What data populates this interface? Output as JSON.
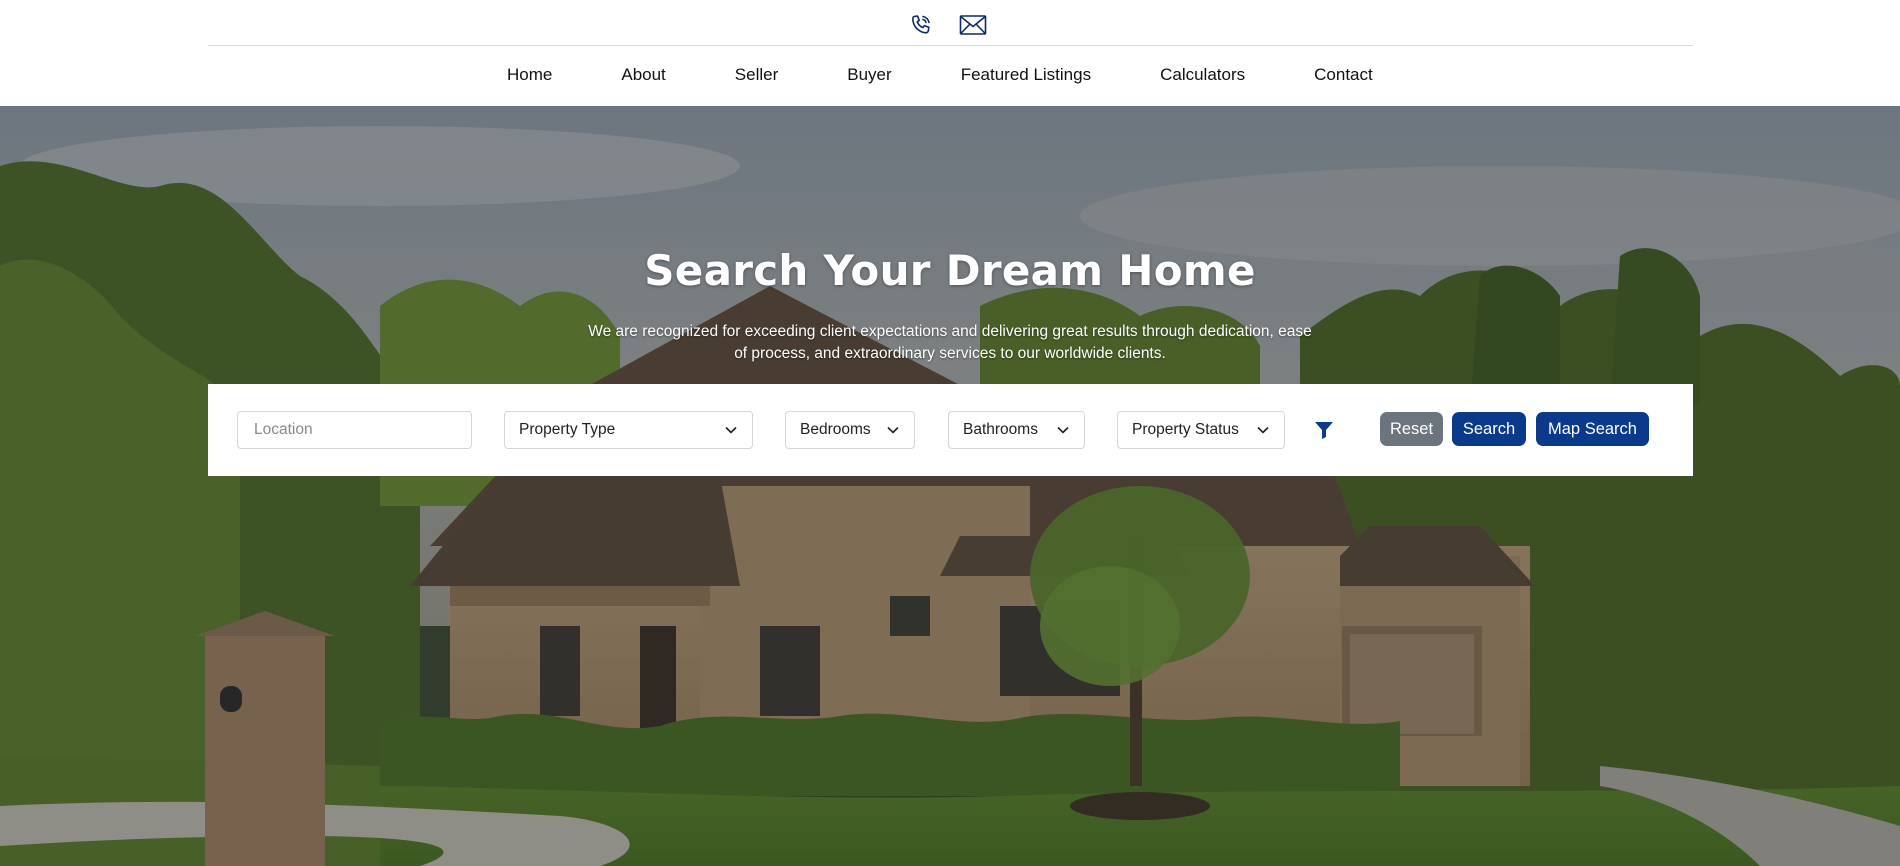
{
  "header": {
    "icons": [
      "phone-icon",
      "mail-icon"
    ],
    "nav": [
      {
        "label": "Home"
      },
      {
        "label": "About"
      },
      {
        "label": "Seller"
      },
      {
        "label": "Buyer"
      },
      {
        "label": "Featured Listings"
      },
      {
        "label": "Calculators"
      },
      {
        "label": "Contact"
      }
    ]
  },
  "hero": {
    "title": "Search Your Dream Home",
    "subtitle": "We are recognized for exceeding client expectations and delivering great results through dedication, ease of process, and extraordinary services to our worldwide clients."
  },
  "search": {
    "location_placeholder": "Location",
    "property_type": "Property Type",
    "bedrooms": "Bedrooms",
    "bathrooms": "Bathrooms",
    "property_status": "Property Status",
    "reset_label": "Reset",
    "search_label": "Search",
    "map_search_label": "Map Search",
    "filter_icon": "filter-icon"
  },
  "colors": {
    "primary": "#0b3a8a",
    "reset": "#6c757d"
  }
}
